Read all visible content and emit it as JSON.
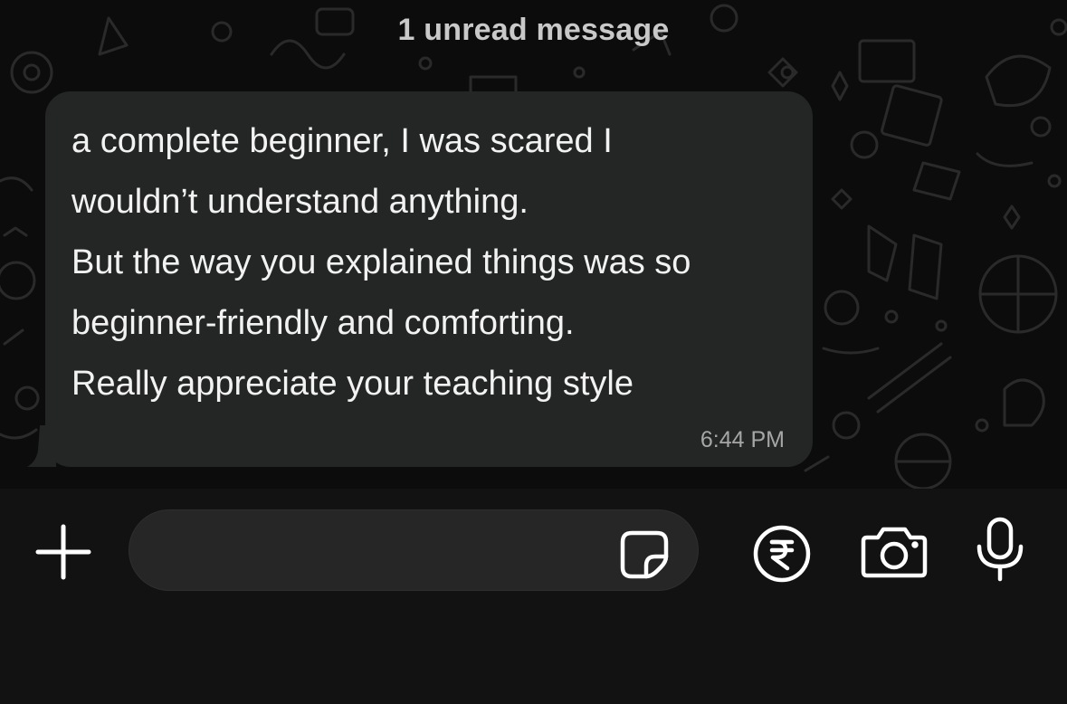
{
  "colors": {
    "chat_background": "#0c0c0c",
    "bubble": "#242626",
    "message_text": "#f2f2f2",
    "timestamp_text": "#a6a6a6",
    "banner_text": "#c9c9c9",
    "composer_background": "#121212",
    "input_field": "#262626",
    "icons": "#ffffff"
  },
  "chat": {
    "unread_banner": "1 unread message",
    "message": {
      "lines": [
        "a complete beginner, I was scared I",
        "wouldn’t understand anything.",
        "But the way you explained things was so",
        "beginner-friendly and comforting.",
        "Really appreciate your teaching style"
      ],
      "time": "6:44 PM"
    }
  },
  "composer": {
    "input_value": "",
    "icons": {
      "attach": "plus-icon",
      "sticker": "sticker-icon",
      "payment": "rupee-icon",
      "camera": "camera-icon",
      "voice": "microphone-icon"
    }
  }
}
